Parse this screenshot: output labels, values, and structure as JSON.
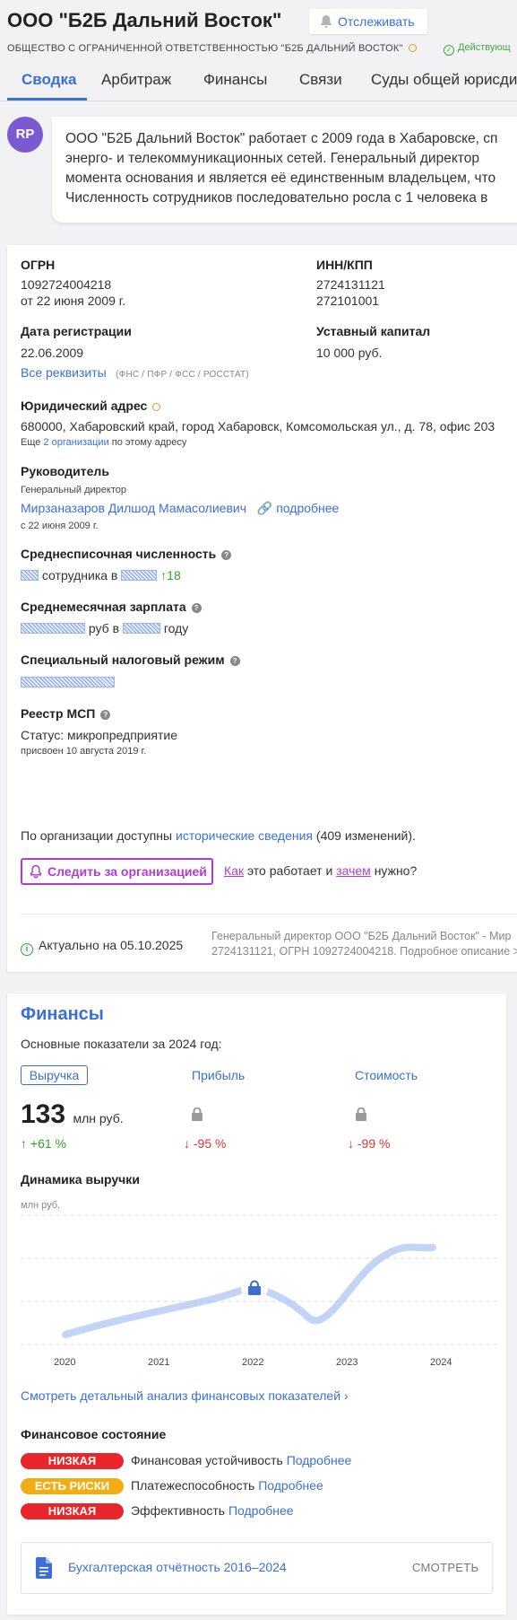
{
  "header": {
    "title": "ООО \"Б2Б Дальний Восток\"",
    "follow_label": "Отслеживать",
    "full_name": "ОБЩЕСТВО С ОГРАНИЧЕННОЙ ОТВЕТСТВЕННОСТЬЮ \"Б2Б ДАЛЬНИЙ ВОСТОК\"",
    "status": "Действующ"
  },
  "tabs": [
    "Сводка",
    "Арбитраж",
    "Финансы",
    "Связи",
    "Суды общей юрисди"
  ],
  "summary": {
    "avatar": "RP",
    "lines": [
      "ООО \"Б2Б Дальний Восток\" работает с 2009 года в Хабаровске, сп",
      "энерго- и телекоммуникационных сетей. Генеральный директор",
      "момента основания и является её единственным владельцем, что",
      "Численность сотрудников последовательно росла с 1 человека в"
    ]
  },
  "requisites": {
    "ogrn_label": "ОГРН",
    "ogrn": "1092724004218",
    "ogrn_date": "от 22 июня 2009 г.",
    "inn_label": "ИНН/КПП",
    "inn": "2724131121",
    "kpp": "272101001",
    "reg_label": "Дата регистрации",
    "reg_date": "22.06.2009",
    "capital_label": "Уставный капитал",
    "capital": "10 000 руб.",
    "all_req": "Все реквизиты",
    "all_req_note": "(ФНС / ПФР / ФСС / РОССТАТ)",
    "address_label": "Юридический адрес",
    "address": "680000, Хабаровский край, город Хабаровск, Комсомольская ул., д. 78, офис 203",
    "address_more_pre": "Еще",
    "address_more_link": "2 организации",
    "address_more_post": "по этому адресу",
    "head_label": "Руководитель",
    "head_role": "Генеральный директор",
    "head_name": "Мирзаназаров Дилшод Мамасолиевич",
    "head_more": "подробнее",
    "head_since": "с 22 июня 2009 г.",
    "staff_label": "Среднесписочная численность",
    "staff_text": "сотрудника в",
    "staff_delta": "18",
    "salary_label": "Среднемесячная зарплата",
    "salary_text1": "руб в",
    "salary_text2": "году",
    "tax_label": "Специальный налоговый режим",
    "msp_label": "Реестр МСП",
    "msp_status": "Статус: микропредприятие",
    "msp_date": "присвоен 10 августа 2019 г.",
    "history_pre": "По организации доступны",
    "history_link": "исторические сведения",
    "history_post": "(409 изменений).",
    "track_button": "Следить за организацией",
    "how_link": "Как",
    "how_mid": "это работает и",
    "why_link": "зачем",
    "why_post": "нужно?",
    "actual": "Актуально на 05.10.2025",
    "footer_line1": "Генеральный директор ООО \"Б2Б Дальний Восток\" - Мир",
    "footer_line2": "2724131121, ОГРН 1092724004218. Подробное описание >"
  },
  "finance": {
    "title": "Финансы",
    "subtitle": "Основные показатели за 2024 год:",
    "tab_revenue": "Выручка",
    "tab_profit": "Прибыль",
    "tab_value": "Стоимость",
    "revenue_value": "133",
    "revenue_unit": "млн руб.",
    "revenue_change": "+61 %",
    "profit_change": "-95 %",
    "value_change": "-99 %",
    "dynamics_title": "Динамика выручки",
    "chart_unit": "млн руб.",
    "years": [
      "2020",
      "2021",
      "2022",
      "2023",
      "2024"
    ],
    "analysis_link": "Смотреть детальный анализ финансовых показателей",
    "state_title": "Финансовое состояние",
    "states": [
      {
        "badge": "НИЗКАЯ",
        "text": "Финансовая устойчивость",
        "link": "Подробнее"
      },
      {
        "badge": "ЕСТЬ РИСКИ",
        "text": "Платежеспособность",
        "link": "Подробнее"
      },
      {
        "badge": "НИЗКАЯ",
        "text": "Эффективность",
        "link": "Подробнее"
      }
    ],
    "report_label": "Бухгалтерская отчётность 2016–2024",
    "report_action": "СМОТРЕТЬ"
  }
}
